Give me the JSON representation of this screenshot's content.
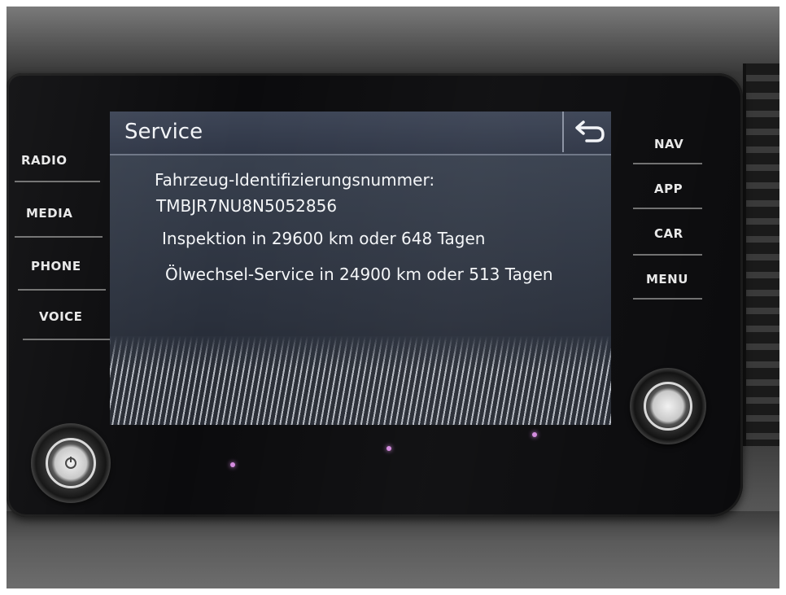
{
  "left_buttons": [
    {
      "label": "RADIO"
    },
    {
      "label": "MEDIA"
    },
    {
      "label": "PHONE"
    },
    {
      "label": "VOICE"
    }
  ],
  "right_buttons": [
    {
      "label": "NAV"
    },
    {
      "label": "APP"
    },
    {
      "label": "CAR"
    },
    {
      "label": "MENU"
    }
  ],
  "screen": {
    "title": "Service",
    "back_icon": "back-arrow-icon",
    "lines": [
      "Fahrzeug-Identifizierungsnummer:",
      "TMBJR7NU8N5052856",
      "Inspektion in 29600 km oder 648 Tagen",
      "Ölwechsel-Service in 24900 km oder 513 Tagen"
    ]
  },
  "colors": {
    "screen_bg": "#2c3342",
    "text": "#f4f6f8",
    "indicator_dot": "#d58be0"
  },
  "knobs": {
    "left": "power-volume-knob",
    "right": "tuning-knob"
  }
}
